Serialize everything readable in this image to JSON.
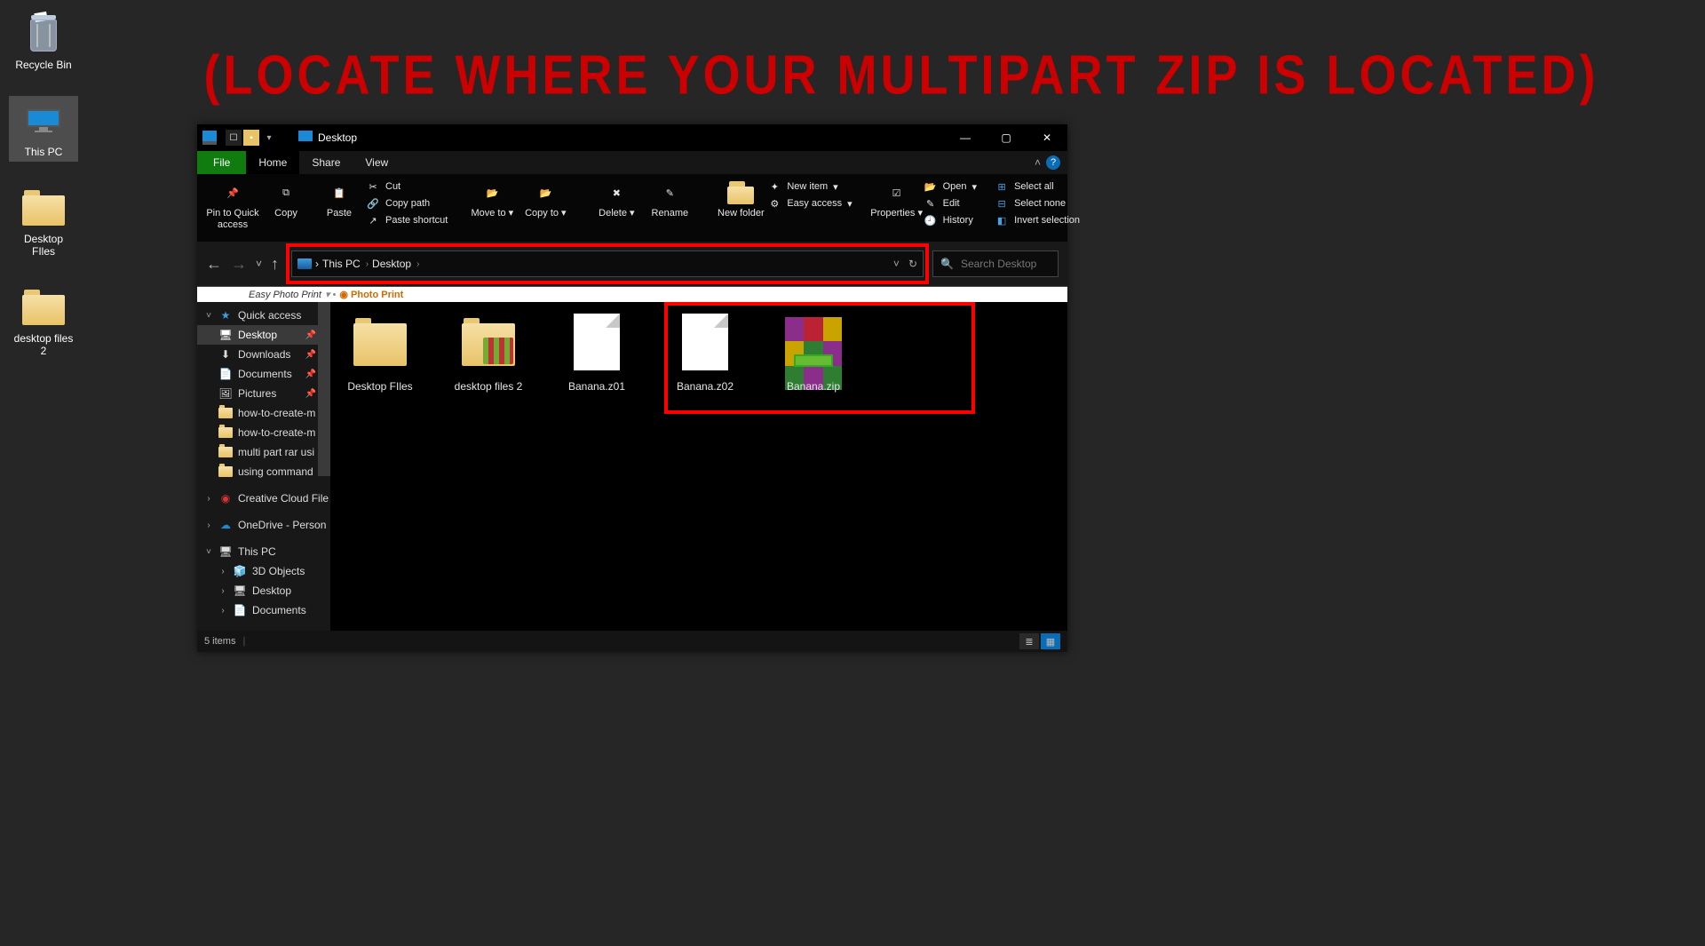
{
  "annotation": "(LOCATE WHERE YOUR MULTIPART ZIP IS LOCATED)",
  "desktop": {
    "icons": [
      {
        "label": "Recycle Bin",
        "type": "bin"
      },
      {
        "label": "This PC",
        "type": "pc",
        "selected": true
      },
      {
        "label": "Desktop FIles",
        "type": "folder"
      },
      {
        "label": "desktop files 2",
        "type": "folder"
      }
    ]
  },
  "explorer": {
    "title": "Desktop",
    "window_controls": {
      "min": "—",
      "max": "▢",
      "close": "✕"
    },
    "tabs": {
      "file": "File",
      "home": "Home",
      "share": "Share",
      "view": "View"
    },
    "ribbon": {
      "pin": "Pin to Quick access",
      "copy": "Copy",
      "paste": "Paste",
      "cut": "Cut",
      "copy_path": "Copy path",
      "paste_shortcut": "Paste shortcut",
      "move_to": "Move to",
      "copy_to": "Copy to",
      "delete": "Delete",
      "rename": "Rename",
      "new_folder": "New folder",
      "new_item": "New item",
      "easy_access": "Easy access",
      "properties": "Properties",
      "open": "Open",
      "edit": "Edit",
      "history": "History",
      "select_all": "Select all",
      "select_none": "Select none",
      "invert": "Invert selection"
    },
    "epson_bar": {
      "left": "Easy Photo Print",
      "right": "Photo Print"
    },
    "nav": {
      "breadcrumbs": [
        "This PC",
        "Desktop"
      ],
      "refresh": "↻",
      "search_placeholder": "Search Desktop"
    },
    "sidebar": {
      "quick_access": "Quick access",
      "items_qa": [
        {
          "label": "Desktop",
          "pinned": true,
          "selected": true,
          "icon": "monitor"
        },
        {
          "label": "Downloads",
          "pinned": true,
          "icon": "download"
        },
        {
          "label": "Documents",
          "pinned": true,
          "icon": "doc"
        },
        {
          "label": "Pictures",
          "pinned": true,
          "icon": "pic"
        },
        {
          "label": "how-to-create-m",
          "icon": "folder"
        },
        {
          "label": "how-to-create-m",
          "icon": "folder"
        },
        {
          "label": "multi part rar usi",
          "icon": "folder"
        },
        {
          "label": "using command",
          "icon": "folder"
        }
      ],
      "creative_cloud": "Creative Cloud File",
      "onedrive": "OneDrive - Person",
      "this_pc": "This PC",
      "items_pc": [
        {
          "label": "3D Objects"
        },
        {
          "label": "Desktop"
        },
        {
          "label": "Documents"
        }
      ]
    },
    "files": [
      {
        "label": "Desktop FIles",
        "type": "folder"
      },
      {
        "label": "desktop files 2",
        "type": "folder-thumb"
      },
      {
        "label": "Banana.z01",
        "type": "file"
      },
      {
        "label": "Banana.z02",
        "type": "file"
      },
      {
        "label": "Banana.zip",
        "type": "rar"
      }
    ],
    "status": "5 items"
  }
}
